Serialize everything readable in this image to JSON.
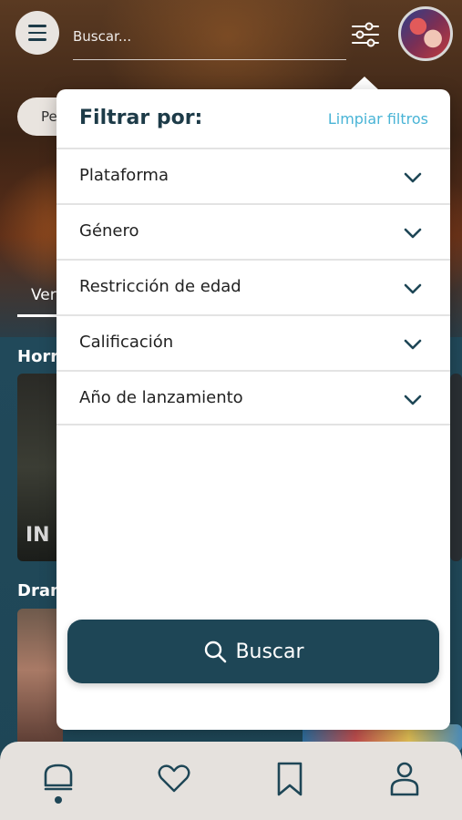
{
  "search": {
    "placeholder": "Buscar..."
  },
  "background": {
    "pill_label": "Pe",
    "tab_label": "Ver",
    "section_1": "Horr",
    "section_2": "Dram",
    "card_text": "IN"
  },
  "filter_panel": {
    "title": "Filtrar por:",
    "clear_label": "Limpiar filtros",
    "filters": [
      {
        "label": "Plataforma"
      },
      {
        "label": "Género"
      },
      {
        "label": "Restricción de edad"
      },
      {
        "label": "Calificación"
      },
      {
        "label": "Año de lanzamiento"
      }
    ],
    "search_button_label": "Buscar"
  },
  "bottom_nav": {
    "items": [
      {
        "icon": "home-icon",
        "active": true
      },
      {
        "icon": "heart-icon",
        "active": false
      },
      {
        "icon": "bookmark-icon",
        "active": false
      },
      {
        "icon": "user-icon",
        "active": false
      }
    ]
  },
  "colors": {
    "primary": "#1e4656",
    "accent": "#49b4d6",
    "panel": "#ffffff"
  }
}
